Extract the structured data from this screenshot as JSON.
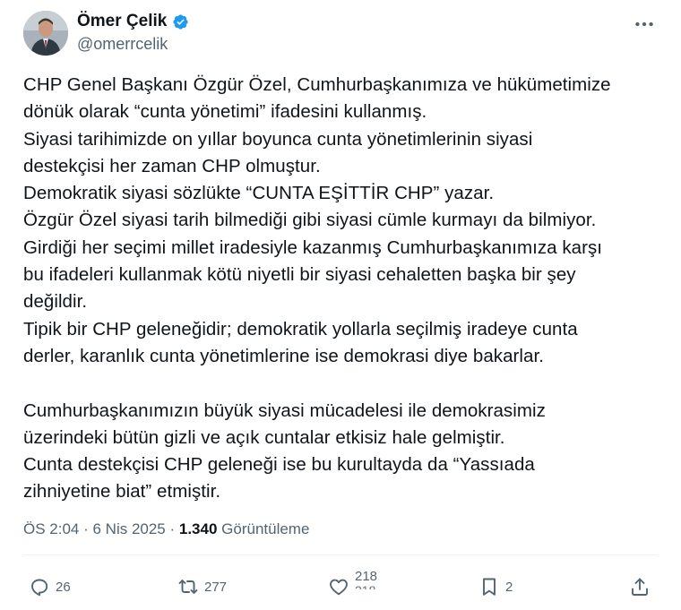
{
  "author": {
    "name": "Ömer Çelik",
    "handle": "@omerrcelik",
    "verified": true
  },
  "tweet": {
    "lines": [
      "CHP Genel Başkanı Özgür Özel, Cumhurbaşkanımıza ve hükümetimize",
      "dönük olarak “cunta yönetimi” ifadesini kullanmış.",
      "Siyasi tarihimizde on yıllar boyunca cunta yönetimlerinin siyasi",
      "destekçisi her zaman CHP olmuştur.",
      "Demokratik siyasi sözlükte “CUNTA EŞİTTİR CHP” yazar.",
      "Özgür Özel siyasi tarih bilmediği gibi siyasi cümle kurmayı da bilmiyor.",
      "Girdiği her seçimi millet iradesiyle kazanmış Cumhurbaşkanımıza karşı",
      "bu ifadeleri kullanmak kötü niyetli bir siyasi cehaletten başka bir şey",
      "değildir.",
      "Tipik bir CHP geleneğidir; demokratik yollarla seçilmiş iradeye cunta",
      "derler, karanlık cunta yönetimlerine ise demokrasi diye bakarlar.",
      "",
      "Cumhurbaşkanımızın büyük siyasi mücadelesi ile demokrasimiz",
      "üzerindeki bütün gizli ve açık cuntalar etkisiz hale gelmiştir.",
      "Cunta destekçisi CHP geleneği ise bu kurultayda da “Yassıada",
      "zihniyetine biat” etmiştir."
    ]
  },
  "meta": {
    "time": "ÖS 2:04",
    "sep1": " · ",
    "date": "6 Nis 2025",
    "sep2": " · ",
    "views_count": "1.340",
    "views_label": " Görüntüleme"
  },
  "actions": {
    "replies": "26",
    "retweets": "277",
    "likes": "218",
    "bookmarks": "2"
  },
  "colors": {
    "verified": "#1d9bf0",
    "muted": "#536471",
    "text": "#0f1419"
  },
  "icons": [
    "verified-badge-icon",
    "more-icon",
    "reply-icon",
    "retweet-icon",
    "like-icon",
    "bookmark-icon",
    "share-icon"
  ]
}
